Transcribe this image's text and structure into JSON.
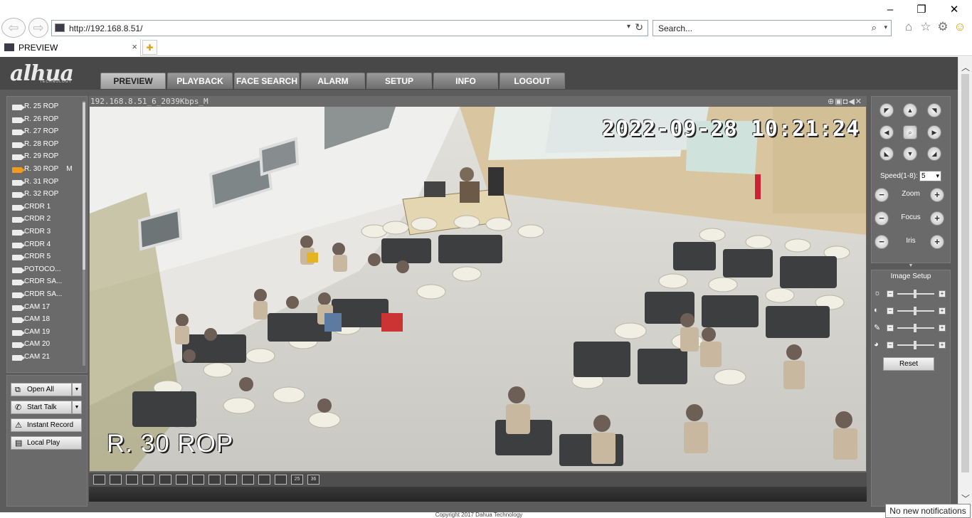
{
  "browser": {
    "url": "http://192.168.8.51/",
    "search_placeholder": "Search...",
    "tab_title": "PREVIEW",
    "tab_close": "×"
  },
  "app": {
    "logo": "a‍lhua",
    "logo_sub": "TECHNOLOGY",
    "menu": [
      {
        "label": "PREVIEW"
      },
      {
        "label": "PLAYBACK"
      },
      {
        "label": "FACE SEARCH"
      },
      {
        "label": "ALARM"
      },
      {
        "label": "SETUP"
      },
      {
        "label": "INFO"
      },
      {
        "label": "LOGOUT"
      }
    ],
    "cameras": [
      {
        "label": "R. 25 ROP"
      },
      {
        "label": "R. 26 ROP"
      },
      {
        "label": "R. 27 ROP"
      },
      {
        "label": "R. 28 ROP"
      },
      {
        "label": "R. 29 ROP"
      },
      {
        "label": "R. 30 ROP    M"
      },
      {
        "label": "R. 31 ROP"
      },
      {
        "label": "R. 32 ROP"
      },
      {
        "label": "CRDR 1"
      },
      {
        "label": "CRDR 2"
      },
      {
        "label": "CRDR 3"
      },
      {
        "label": "CRDR 4"
      },
      {
        "label": "CRDR 5"
      },
      {
        "label": "POTOCO..."
      },
      {
        "label": "CRDR SA..."
      },
      {
        "label": "CRDR SA..."
      },
      {
        "label": "CAM 17"
      },
      {
        "label": "CAM 18"
      },
      {
        "label": "CAM 19"
      },
      {
        "label": "CAM 20"
      },
      {
        "label": "CAM 21"
      }
    ],
    "left_buttons": {
      "open_all": "Open All",
      "start_talk": "Start Talk",
      "instant_record": "Instant Record",
      "local_play": "Local Play"
    },
    "stream_title": "192.168.8.51_6_2039Kbps_M",
    "osd_time": "2022-09-28 10:21:24",
    "osd_name": "R. 30 ROP",
    "layout_labels": [
      "",
      "",
      "",
      "",
      "",
      "",
      "",
      "",
      "",
      "",
      "",
      "",
      "",
      "25",
      "36"
    ],
    "ptz": {
      "speed_label": "Speed(1-8):",
      "speed_value": "5",
      "zoom_label": "Zoom",
      "focus_label": "Focus",
      "iris_label": "Iris"
    },
    "image_setup": {
      "title": "Image Setup",
      "reset": "Reset"
    },
    "footer": "Copyright 2017 Dahua Technology"
  },
  "notification": "No new notifications",
  "colors": {
    "app_bg": "#5c5c5c",
    "panel_bg": "#6a6a6a",
    "recording_icon": "#f29a1c"
  }
}
